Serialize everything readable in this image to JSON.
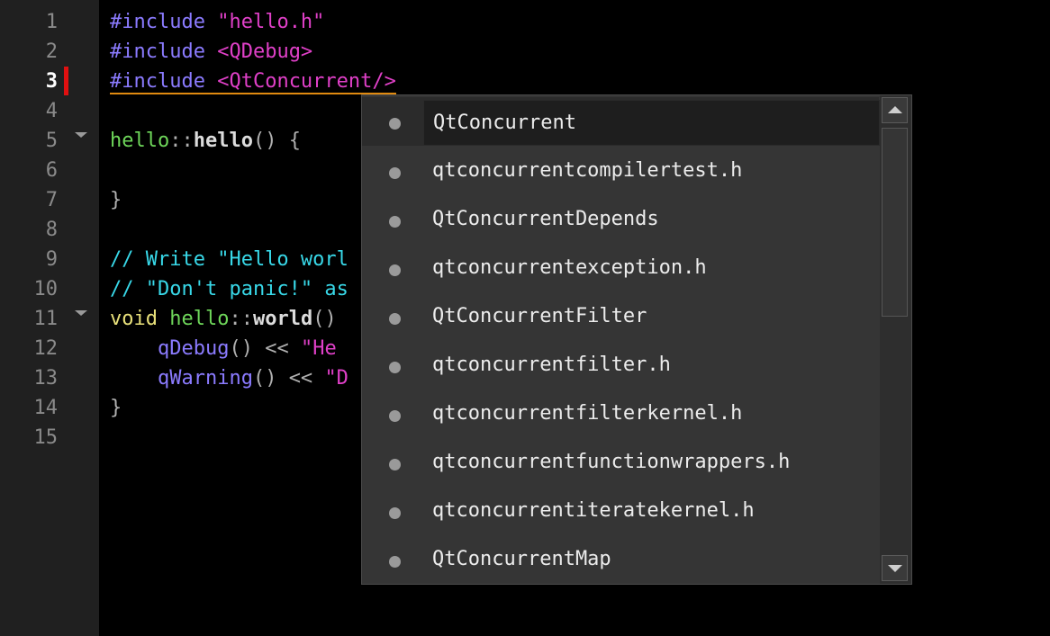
{
  "editor": {
    "line_numbers": [
      "1",
      "2",
      "3",
      "4",
      "5",
      "6",
      "7",
      "8",
      "9",
      "10",
      "11",
      "12",
      "13",
      "14",
      "15"
    ],
    "lines": {
      "l1": {
        "directive": "#include",
        "arg": "\"hello.h\""
      },
      "l2": {
        "directive": "#include",
        "arg": "<QDebug>"
      },
      "l3": {
        "directive": "#include",
        "arg": "<QtConcurrent/>"
      },
      "l5": {
        "cls": "hello",
        "sep": "::",
        "method": "hello",
        "rest": "() {"
      },
      "l7": {
        "text": "}"
      },
      "l9": {
        "text": "// Write \"Hello worl"
      },
      "l10": {
        "text": "// \"Don't panic!\" as"
      },
      "l11": {
        "kw": "void",
        "cls": "hello",
        "sep": "::",
        "method": "world",
        "rest": "()"
      },
      "l12": {
        "indent": "    ",
        "fn": "qDebug",
        "ops": "() << ",
        "str": "\"He"
      },
      "l13": {
        "indent": "    ",
        "fn": "qWarning",
        "ops": "() << ",
        "str": "\"D"
      },
      "l14": {
        "text": "}"
      }
    }
  },
  "completion": {
    "items": [
      "QtConcurrent",
      "qtconcurrentcompilertest.h",
      "QtConcurrentDepends",
      "qtconcurrentexception.h",
      "QtConcurrentFilter",
      "qtconcurrentfilter.h",
      "qtconcurrentfilterkernel.h",
      "qtconcurrentfunctionwrappers.h",
      "qtconcurrentiteratekernel.h",
      "QtConcurrentMap"
    ],
    "selected_index": 0
  },
  "colors": {
    "background": "#000000",
    "gutter": "#202020",
    "preprocessor": "#8b7bff",
    "string": "#e040c8",
    "class_name": "#6ed65a",
    "comment": "#38d8e8",
    "keyword": "#e8e07a",
    "error_marker": "#e01010",
    "popup_bg": "#353535"
  }
}
